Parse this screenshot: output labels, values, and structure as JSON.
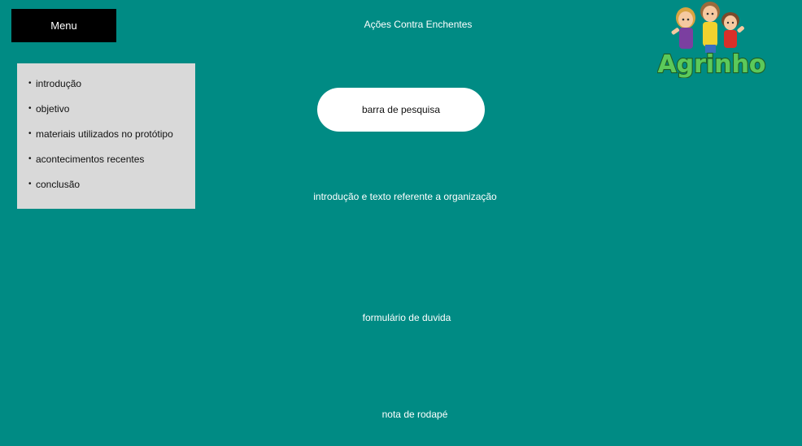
{
  "header": {
    "menu_label": "Menu",
    "site_title": "Ações Contra Enchentes"
  },
  "menu": {
    "items": [
      {
        "label": "introdução"
      },
      {
        "label": "objetivo"
      },
      {
        "label": "materiais utilizados no protótipo"
      },
      {
        "label": "acontecimentos recentes"
      },
      {
        "label": "conclusão"
      }
    ]
  },
  "search": {
    "label": "barra de pesquisa"
  },
  "main": {
    "intro_text": "introdução e texto referente a organização",
    "form_label": "formulário de duvida"
  },
  "footer": {
    "note": "nota de rodapé"
  },
  "logo": {
    "text": "Agrinho",
    "icon": "children-mascot-logo"
  },
  "colors": {
    "background": "#008b84",
    "menu_button": "#000000",
    "menu_panel": "#d9d9d9",
    "search_bar": "#ffffff",
    "logo_green": "#3aa845"
  }
}
